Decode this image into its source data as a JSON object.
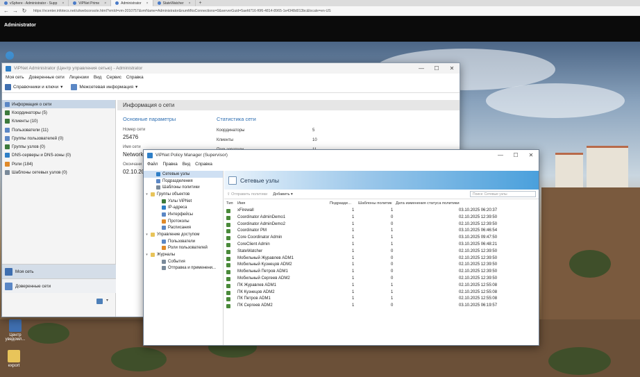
{
  "browser": {
    "tabs": [
      {
        "label": "vSphere - Administrator - Supp",
        "active": false
      },
      {
        "label": "ViPNet Prime",
        "active": false
      },
      {
        "label": "Administrator",
        "active": true
      },
      {
        "label": "StateWatcher",
        "active": false
      }
    ],
    "new_tab": "+",
    "url": "https://vcenter.infotecs.net/ui/webconsole.html?vmId=vm-2010757&vmName=Administrator&numMksConnections=0&serverGuid=5aefd716-f6f6-4814-8965-1e4348d013bc&locale=en-US"
  },
  "console": {
    "title": "Administrator"
  },
  "admin": {
    "title": "ViPNet Administrator (Центр управления сетью) - Administrator",
    "menu": [
      "Моя сеть",
      "Доверенные сети",
      "Лицензии",
      "Вид",
      "Сервис",
      "Справка"
    ],
    "toolbar": [
      "Справочники и ключи",
      "Межсетевая информация"
    ],
    "sidebar": [
      {
        "label": "Информация о сети",
        "selected": true,
        "color": "#5b87c5"
      },
      {
        "label": "Координаторы (5)",
        "selected": false,
        "color": "#3c7a3c"
      },
      {
        "label": "Клиенты (10)",
        "selected": false,
        "color": "#3c7a3c"
      },
      {
        "label": "Пользователи (11)",
        "selected": false,
        "color": "#5b87c5"
      },
      {
        "label": "Группы пользователей (0)",
        "selected": false,
        "color": "#5b87c5"
      },
      {
        "label": "Группы узлов (0)",
        "selected": false,
        "color": "#3c7a3c"
      },
      {
        "label": "DNS-серверы и DNS-зоны (0)",
        "selected": false,
        "color": "#2f7fc7"
      },
      {
        "label": "Роли (184)",
        "selected": false,
        "color": "#e08a2a"
      },
      {
        "label": "Шаблоны сетевых узлов (0)",
        "selected": false,
        "color": "#7a8a9a"
      }
    ],
    "sidebar_bottom": [
      "Моя сеть",
      "Доверенные сети"
    ],
    "main": {
      "header": "Информация о сети",
      "basic_title": "Основные параметры",
      "stats_title": "Статистика сети",
      "network_number_label": "Номер сети",
      "network_number": "25476",
      "network_name_label": "Имя сети",
      "network_name": "Network",
      "end_label": "Окончани",
      "end_value": "02.10.202",
      "stats": [
        {
          "label": "Координаторы",
          "value": "5"
        },
        {
          "label": "Клиенты",
          "value": "10"
        },
        {
          "label": "Пользователи",
          "value": "11"
        }
      ]
    }
  },
  "policy_manager": {
    "title": "ViPNet Policy Manager (Supervisor)",
    "menu": [
      "Файл",
      "Правка",
      "Вид",
      "Справка"
    ],
    "tree": [
      {
        "label": "Сетевые узлы",
        "level": 1,
        "caret": "",
        "selected": true,
        "color": "#2f7fc7"
      },
      {
        "label": "Подразделения",
        "level": 1,
        "caret": "",
        "selected": false,
        "color": "#5b87c5"
      },
      {
        "label": "Шаблоны политики",
        "level": 1,
        "caret": "",
        "selected": false,
        "color": "#7a8a9a"
      },
      {
        "label": "Группы объектов",
        "level": 0,
        "caret": "▾",
        "selected": false,
        "color": "#e8c45a"
      },
      {
        "label": "Узлы ViPNet",
        "level": 2,
        "caret": "",
        "selected": false,
        "color": "#3c7a3c"
      },
      {
        "label": "IP-адреса",
        "level": 2,
        "caret": "",
        "selected": false,
        "color": "#2f7fc7"
      },
      {
        "label": "Интерфейсы",
        "level": 2,
        "caret": "",
        "selected": false,
        "color": "#5b87c5"
      },
      {
        "label": "Протоколы",
        "level": 2,
        "caret": "",
        "selected": false,
        "color": "#e08a2a"
      },
      {
        "label": "Расписания",
        "level": 2,
        "caret": "",
        "selected": false,
        "color": "#5b87c5"
      },
      {
        "label": "Управление доступом",
        "level": 0,
        "caret": "▾",
        "selected": false,
        "color": "#e8c45a"
      },
      {
        "label": "Пользователи",
        "level": 2,
        "caret": "",
        "selected": false,
        "color": "#5b87c5"
      },
      {
        "label": "Роли пользователей",
        "level": 2,
        "caret": "",
        "selected": false,
        "color": "#e08a2a"
      },
      {
        "label": "Журналы",
        "level": 0,
        "caret": "▾",
        "selected": false,
        "color": "#e8c45a"
      },
      {
        "label": "События",
        "level": 2,
        "caret": "",
        "selected": false,
        "color": "#7a8a9a"
      },
      {
        "label": "Отправка и применени...",
        "level": 2,
        "caret": "",
        "selected": false,
        "color": "#7a8a9a"
      }
    ],
    "banner_title": "Сетевые узлы",
    "toolbar": {
      "send": "Отправить политики",
      "add": "Добавить ▾"
    },
    "search_placeholder": "Поиск: Сетевые узлы",
    "columns": [
      "Тип",
      "Имя",
      "Подразде...",
      "Шаблоны политик",
      "Дата изменения статуса политики"
    ],
    "rows": [
      {
        "name": "xFirewall",
        "dept": "1",
        "tpl": "1",
        "date": "03.10.2025 06:20:37"
      },
      {
        "name": "Coordinator AdminDemo1",
        "dept": "1",
        "tpl": "0",
        "date": "02.10.2025 12:39:50"
      },
      {
        "name": "Coordinator AdminDemo2",
        "dept": "1",
        "tpl": "0",
        "date": "02.10.2025 12:39:50"
      },
      {
        "name": "Coordinator PM",
        "dept": "1",
        "tpl": "1",
        "date": "03.10.2025 06:46:54"
      },
      {
        "name": "Core Coordinator Admin",
        "dept": "1",
        "tpl": "1",
        "date": "03.10.2025 09:47:50"
      },
      {
        "name": "CoreClient Admin",
        "dept": "1",
        "tpl": "1",
        "date": "03.10.2025 06:48:21"
      },
      {
        "name": "StateWatcher",
        "dept": "1",
        "tpl": "0",
        "date": "02.10.2025 12:39:50"
      },
      {
        "name": "Мобильный Журавлев ADM1",
        "dept": "1",
        "tpl": "0",
        "date": "02.10.2025 12:39:50"
      },
      {
        "name": "Мобильный Кузнецов ADM2",
        "dept": "1",
        "tpl": "0",
        "date": "02.10.2025 12:39:50"
      },
      {
        "name": "Мобильный Петров ADM1",
        "dept": "1",
        "tpl": "0",
        "date": "02.10.2025 12:39:50"
      },
      {
        "name": "Мобильный Сергеев ADM2",
        "dept": "1",
        "tpl": "0",
        "date": "02.10.2025 12:39:50"
      },
      {
        "name": "ПК Журавлев ADM1",
        "dept": "1",
        "tpl": "1",
        "date": "02.10.2025 12:55:08"
      },
      {
        "name": "ПК Кузнецов ADM2",
        "dept": "1",
        "tpl": "1",
        "date": "02.10.2025 12:55:08"
      },
      {
        "name": "ПК Петров ADM1",
        "dept": "1",
        "tpl": "1",
        "date": "02.10.2025 12:55:08"
      },
      {
        "name": "ПК Сергеев ADM2",
        "dept": "1",
        "tpl": "0",
        "date": "03.10.2025 06:19:57"
      }
    ]
  },
  "desktop": {
    "icons": [
      {
        "label": "Центр уведомл...",
        "color": "#3f6fb0"
      },
      {
        "label": "export",
        "color": "#e8c45a"
      }
    ]
  },
  "colors": {
    "accent": "#2f7fc7",
    "console_bar": "#0b0b0b",
    "selection": "#c8d6e6"
  }
}
